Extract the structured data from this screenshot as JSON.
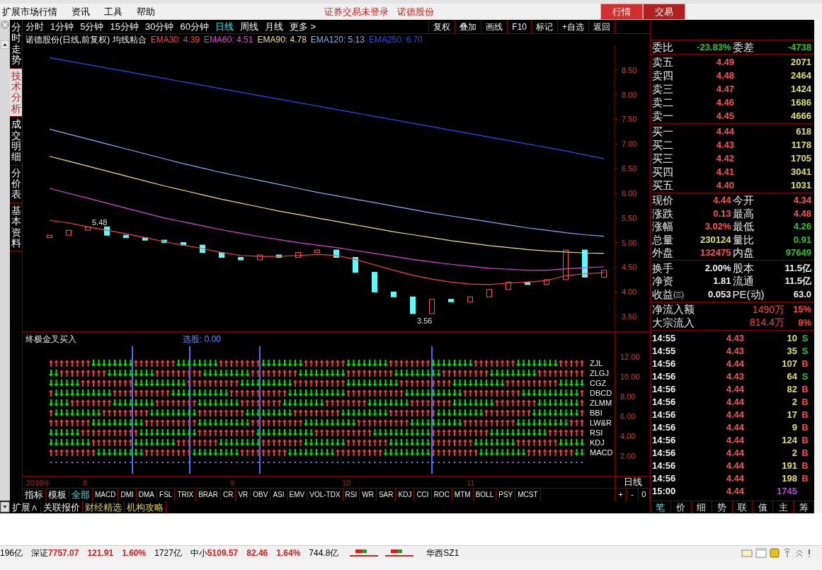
{
  "menu_bar": {
    "items": [
      "扩展市场行情",
      "资讯",
      "工具",
      "帮助"
    ],
    "notices": [
      "证券交易未登录",
      "诺德股份"
    ],
    "buttons": [
      {
        "label": "行情",
        "selected": true
      },
      {
        "label": "交易",
        "selected": false
      }
    ]
  },
  "side_tabs": [
    {
      "label": "分时走势",
      "selected": false
    },
    {
      "label": "技术分析",
      "selected": true
    },
    {
      "label": "成交明细",
      "selected": false
    },
    {
      "label": "分价表",
      "selected": false
    },
    {
      "label": "基本资料",
      "selected": false
    }
  ],
  "periods": [
    {
      "label": "分时",
      "selected": false
    },
    {
      "label": "1分钟",
      "selected": false
    },
    {
      "label": "5分钟",
      "selected": false
    },
    {
      "label": "15分钟",
      "selected": false
    },
    {
      "label": "30分钟",
      "selected": false
    },
    {
      "label": "60分钟",
      "selected": false
    },
    {
      "label": "日线",
      "selected": true
    },
    {
      "label": "周线",
      "selected": false
    },
    {
      "label": "月线",
      "selected": false
    },
    {
      "label": "更多 >",
      "selected": false
    }
  ],
  "chart_tools": [
    "复权",
    "叠加",
    "画线",
    "F10",
    "标记",
    "+自选",
    "返回"
  ],
  "chart_title": "诺德股份(日线,前复权) 均线粘合",
  "ema_legend": [
    ": 4.39",
    ": 4.51",
    ": 4.78",
    ": 5.13",
    ": 6.70"
  ],
  "main_chart": {
    "chart_data": {
      "type": "line",
      "ylim": [
        3.2,
        9.0
      ],
      "yticks": [
        {
          "value": 8.5,
          "label": "8.50"
        },
        {
          "value": 8,
          "label": "8.00"
        },
        {
          "value": 7.5,
          "label": "7.50"
        },
        {
          "value": 7,
          "label": "7.00"
        },
        {
          "value": 6.5,
          "label": "6.50"
        },
        {
          "value": 6,
          "label": "6.00"
        },
        {
          "value": 5.5,
          "label": "5.50"
        },
        {
          "value": 5,
          "label": "5.00"
        },
        {
          "value": 4.5,
          "label": "4.50"
        },
        {
          "value": 4,
          "label": "4.00"
        },
        {
          "value": 3.5,
          "label": "3.50"
        }
      ],
      "series": [
        {
          "name": "EMA30",
          "color": "#ff4040",
          "values": [
            5.45,
            5.4,
            5.32,
            5.25,
            5.18,
            5.1,
            5.02,
            4.95,
            4.88,
            4.8,
            4.74,
            4.72,
            4.72,
            4.74,
            4.76,
            4.74,
            4.66,
            4.55,
            4.44,
            4.34,
            4.26,
            4.2,
            4.16,
            4.15,
            4.18,
            4.2,
            4.23,
            4.33,
            4.37,
            4.39
          ]
        },
        {
          "name": "EMA60",
          "color": "#e040e0",
          "values": [
            6.1,
            6.0,
            5.9,
            5.8,
            5.7,
            5.6,
            5.5,
            5.42,
            5.34,
            5.26,
            5.19,
            5.12,
            5.06,
            5.0,
            4.95,
            4.9,
            4.84,
            4.78,
            4.72,
            4.66,
            4.61,
            4.56,
            4.52,
            4.48,
            4.46,
            4.44,
            4.44,
            4.47,
            4.49,
            4.51
          ]
        },
        {
          "name": "EMA90",
          "color": "#f0e070",
          "values": [
            6.75,
            6.65,
            6.55,
            6.45,
            6.35,
            6.25,
            6.15,
            6.06,
            5.97,
            5.88,
            5.8,
            5.72,
            5.64,
            5.57,
            5.5,
            5.43,
            5.36,
            5.29,
            5.22,
            5.16,
            5.1,
            5.04,
            4.99,
            4.94,
            4.9,
            4.86,
            4.83,
            4.81,
            4.79,
            4.78
          ]
        },
        {
          "name": "EMA120",
          "color": "#80b0ff",
          "values": [
            7.3,
            7.2,
            7.1,
            7.0,
            6.9,
            6.8,
            6.7,
            6.6,
            6.51,
            6.42,
            6.34,
            6.26,
            6.18,
            6.1,
            6.02,
            5.95,
            5.88,
            5.81,
            5.74,
            5.67,
            5.6,
            5.54,
            5.48,
            5.42,
            5.36,
            5.3,
            5.25,
            5.2,
            5.16,
            5.13
          ]
        },
        {
          "name": "EMA250",
          "color": "#2848ff",
          "values": [
            8.75,
            8.68,
            8.61,
            8.54,
            8.47,
            8.4,
            8.33,
            8.26,
            8.19,
            8.12,
            8.05,
            7.98,
            7.91,
            7.84,
            7.77,
            7.7,
            7.63,
            7.56,
            7.49,
            7.42,
            7.35,
            7.28,
            7.21,
            7.14,
            7.07,
            7.0,
            6.93,
            6.86,
            6.78,
            6.7
          ]
        }
      ],
      "annotations": [
        "5.48",
        "3.56"
      ]
    }
  },
  "indicator": {
    "title": "终极金叉买入",
    "selection": "选股: 0.00",
    "axis_labels": [
      "12.00",
      "10.00",
      "8.00",
      "6.00",
      "4.00",
      "2.00"
    ],
    "rows": [
      "ZJL",
      "ZLGJ",
      "CGZ",
      "DBCD",
      "ZLMM",
      "BBI",
      "LW&R",
      "RSI",
      "KDJ",
      "MACD"
    ]
  },
  "date_axis": {
    "labels": [
      "2018年",
      "8",
      "9",
      "10",
      "11"
    ],
    "period": "日线"
  },
  "indicator_tabs": [
    {
      "label": "指标",
      "selected": false
    },
    {
      "label": "模板",
      "selected": false
    },
    {
      "label": "全部",
      "selected": true
    },
    {
      "label": "MACD",
      "selected": false
    },
    {
      "label": "DMI",
      "selected": false
    },
    {
      "label": "DMA",
      "selected": false
    },
    {
      "label": "FSL",
      "selected": false
    },
    {
      "label": "TRIX",
      "selected": false
    },
    {
      "label": "BRAR",
      "selected": false
    },
    {
      "label": "CR",
      "selected": false
    },
    {
      "label": "VR",
      "selected": false
    },
    {
      "label": "OBV",
      "selected": false
    },
    {
      "label": "ASI",
      "selected": false
    },
    {
      "label": "EMV",
      "selected": false
    },
    {
      "label": "VOL-TDX",
      "selected": false
    },
    {
      "label": "RSI",
      "selected": false
    },
    {
      "label": "WR",
      "selected": false
    },
    {
      "label": "SAR",
      "selected": false
    },
    {
      "label": "KDJ",
      "selected": false
    },
    {
      "label": "CCI",
      "selected": false
    },
    {
      "label": "ROC",
      "selected": false
    },
    {
      "label": "MTM",
      "selected": false
    },
    {
      "label": "BOLL",
      "selected": false
    },
    {
      "label": "PSY",
      "selected": false
    },
    {
      "label": "MCST",
      "selected": false
    }
  ],
  "zoom_buttons": [
    "+",
    "-",
    "0"
  ],
  "bottom_tabs": [
    {
      "label": "扩展∧",
      "kind": "plain"
    },
    {
      "label": "关联报价",
      "kind": "plain"
    },
    {
      "label": "财经精选",
      "kind": "highlight"
    },
    {
      "label": "机构攻略",
      "kind": "highlight"
    }
  ],
  "quote": {
    "ratio": [
      {
        "label": "委比",
        "value": "-23.83%",
        "kind": "down"
      },
      {
        "label": "委差",
        "value": "-4738",
        "kind": "down"
      }
    ],
    "asks": [
      {
        "label": "卖五",
        "price": "4.49",
        "volume": "2071"
      },
      {
        "label": "卖四",
        "price": "4.48",
        "volume": "2464"
      },
      {
        "label": "卖三",
        "price": "4.47",
        "volume": "1424"
      },
      {
        "label": "卖二",
        "price": "4.46",
        "volume": "1686"
      },
      {
        "label": "卖一",
        "price": "4.45",
        "volume": "4666"
      }
    ],
    "bids": [
      {
        "label": "买一",
        "price": "4.44",
        "volume": "618"
      },
      {
        "label": "买二",
        "price": "4.43",
        "volume": "1178"
      },
      {
        "label": "买三",
        "price": "4.42",
        "volume": "1705"
      },
      {
        "label": "买四",
        "price": "4.41",
        "volume": "3041"
      },
      {
        "label": "买五",
        "price": "4.40",
        "volume": "1031"
      }
    ],
    "stats": [
      [
        {
          "label": "现价",
          "value": "4.44",
          "kind": "up"
        },
        {
          "label": "今开",
          "value": "4.34",
          "kind": "up"
        }
      ],
      [
        {
          "label": "涨跌",
          "value": "0.13",
          "kind": "up"
        },
        {
          "label": "最高",
          "value": "4.48",
          "kind": "up"
        }
      ],
      [
        {
          "label": "涨幅",
          "value": "3.02%",
          "kind": "up"
        },
        {
          "label": "最低",
          "value": "4.26",
          "kind": "down"
        }
      ],
      [
        {
          "label": "总量",
          "value": "230124",
          "kind": "volume"
        },
        {
          "label": "量比",
          "value": "0.91",
          "kind": "down"
        }
      ],
      [
        {
          "label": "外盘",
          "value": "132475",
          "kind": "up"
        },
        {
          "label": "内盘",
          "value": "97649",
          "kind": "down"
        }
      ]
    ],
    "fundamentals": [
      [
        {
          "label": "换手",
          "value": "2.00%",
          "kind": "plain"
        },
        {
          "label": "股本",
          "value": "11.5亿",
          "kind": "plain"
        }
      ],
      [
        {
          "label": "净资",
          "value": "1.81",
          "kind": "plain"
        },
        {
          "label": "流通",
          "value": "11.5亿",
          "kind": "plain"
        }
      ],
      [
        {
          "label": "收益㈢",
          "value": "0.053",
          "kind": "plain"
        },
        {
          "label": "PE(动)",
          "value": "63.0",
          "kind": "plain"
        }
      ]
    ],
    "flows": [
      {
        "label": "净流入额",
        "amount": "1490万",
        "pct": "15%"
      },
      {
        "label": "大宗流入",
        "amount": "814.4万",
        "pct": "8%"
      }
    ]
  },
  "trades": [
    {
      "time": "14:55",
      "price": "4.43",
      "volume": "10",
      "side": "S",
      "kind": "sell"
    },
    {
      "time": "14:55",
      "price": "4.43",
      "volume": "35",
      "side": "S",
      "kind": "sell"
    },
    {
      "time": "14:56",
      "price": "4.44",
      "volume": "107",
      "side": "B",
      "kind": "buy"
    },
    {
      "time": "14:56",
      "price": "4.43",
      "volume": "64",
      "side": "S",
      "kind": "sell"
    },
    {
      "time": "14:56",
      "price": "4.44",
      "volume": "82",
      "side": "B",
      "kind": "buy"
    },
    {
      "time": "14:56",
      "price": "4.44",
      "volume": "2",
      "side": "B",
      "kind": "buy"
    },
    {
      "time": "14:56",
      "price": "4.44",
      "volume": "17",
      "side": "B",
      "kind": "buy"
    },
    {
      "time": "14:56",
      "price": "4.44",
      "volume": "9",
      "side": "B",
      "kind": "buy"
    },
    {
      "time": "14:56",
      "price": "4.44",
      "volume": "124",
      "side": "B",
      "kind": "buy"
    },
    {
      "time": "14:56",
      "price": "4.44",
      "volume": "2",
      "side": "B",
      "kind": "buy"
    },
    {
      "time": "14:56",
      "price": "4.44",
      "volume": "191",
      "side": "B",
      "kind": "buy"
    },
    {
      "time": "14:56",
      "price": "4.44",
      "volume": "198",
      "side": "B",
      "kind": "buy"
    },
    {
      "time": "15:00",
      "price": "4.44",
      "volume": "1745",
      "kind": "closing"
    }
  ],
  "panel_tabs": [
    {
      "label": "笔",
      "selected": true
    },
    {
      "label": "价",
      "selected": false
    },
    {
      "label": "细",
      "selected": false
    },
    {
      "label": "势",
      "selected": false
    },
    {
      "label": "联",
      "selected": false
    },
    {
      "label": "值",
      "selected": false
    },
    {
      "label": "主",
      "selected": false
    },
    {
      "label": "筹",
      "selected": false
    }
  ],
  "status_bar": {
    "items": [
      {
        "kind": "amount",
        "text": "196亿"
      },
      {
        "kind": "index",
        "name": "深证",
        "value": "7757.07",
        "change": "121.91",
        "pct": "1.60%"
      },
      {
        "kind": "amount",
        "text": "1727亿"
      },
      {
        "kind": "index",
        "name": "中小",
        "value": "5109.57",
        "change": "82.46",
        "pct": "1.64%"
      },
      {
        "kind": "amount",
        "text": "744.8亿"
      }
    ],
    "server": "华西SZ1"
  }
}
